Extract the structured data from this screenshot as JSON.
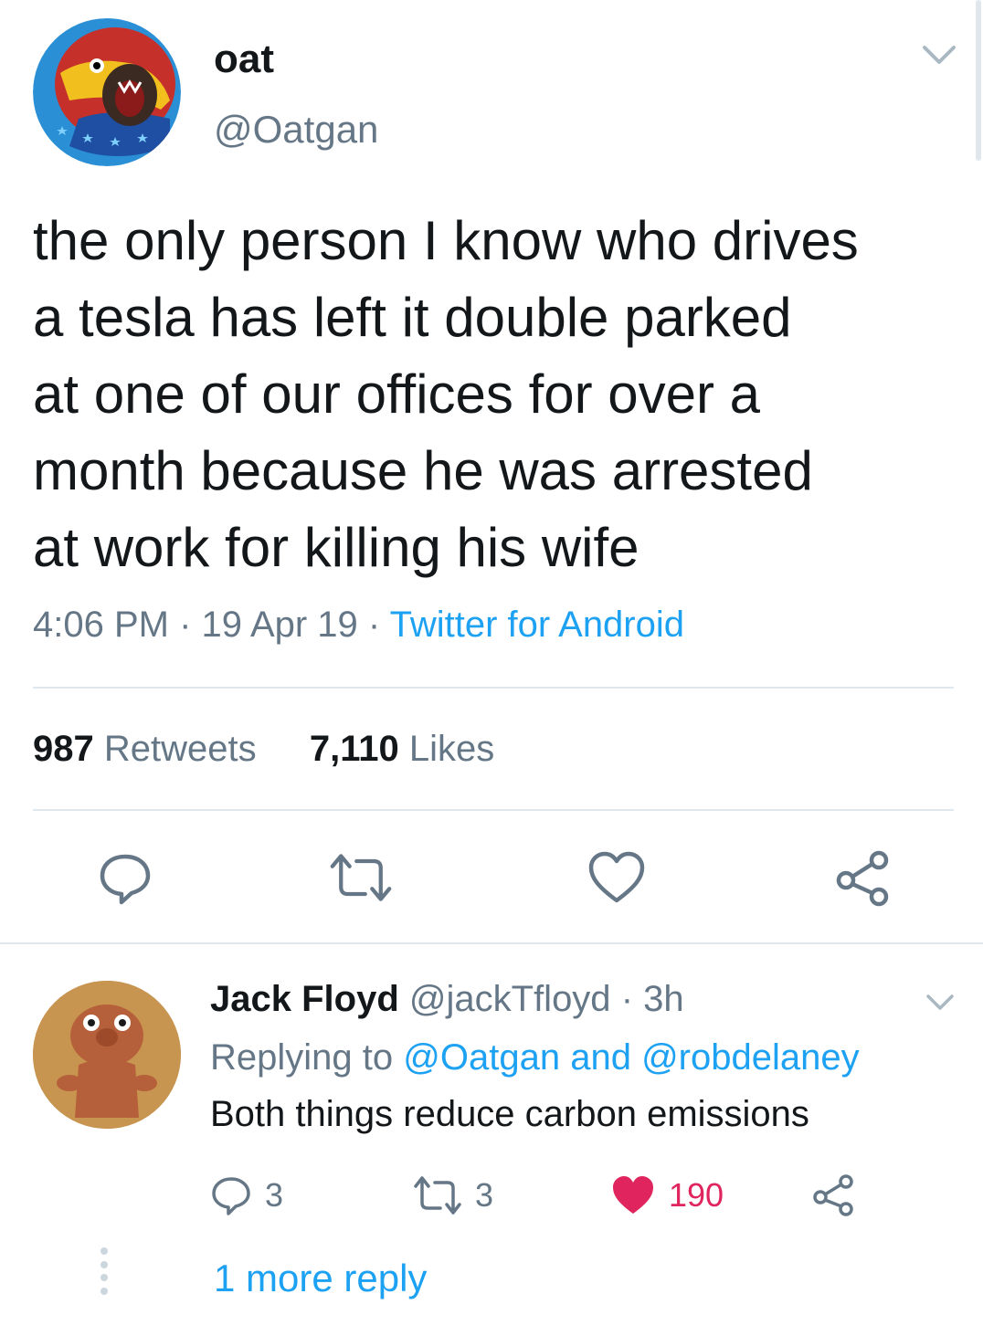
{
  "tweet": {
    "author": {
      "display_name": "oat",
      "handle": "@Oatgan",
      "avatar": "wrestling-mask-avatar"
    },
    "text_lines": [
      "the only person I know who drives",
      "a tesla has left it double parked",
      "at one of our offices for over a",
      "month because he was arrested",
      "at work for killing his wife"
    ],
    "time": "4:06 PM",
    "date": "19 Apr 19",
    "separator": "·",
    "source": "Twitter for Android",
    "retweets_count": "987",
    "retweets_label": "Retweets",
    "likes_count": "7,110",
    "likes_label": "Likes",
    "actions": [
      "reply-icon",
      "retweet-icon",
      "like-icon",
      "share-icon"
    ]
  },
  "reply": {
    "author": {
      "display_name": "Jack Floyd",
      "handle": "@jackTfloyd",
      "age": "3h",
      "avatar": "troll-doll-avatar"
    },
    "separator": "·",
    "replying_prefix": "Replying to",
    "replying_to_1": "@Oatgan",
    "replying_conj": "and",
    "replying_to_2": "@robdelaney",
    "text": "Both things reduce carbon emissions",
    "reply_count": "3",
    "retweet_count": "3",
    "like_count": "190",
    "liked": true,
    "more_replies": "1 more reply"
  },
  "colors": {
    "accent": "#1da1f2",
    "muted": "#657786",
    "text": "#14171a",
    "like": "#e0245e",
    "divider": "#e1e8ed"
  }
}
